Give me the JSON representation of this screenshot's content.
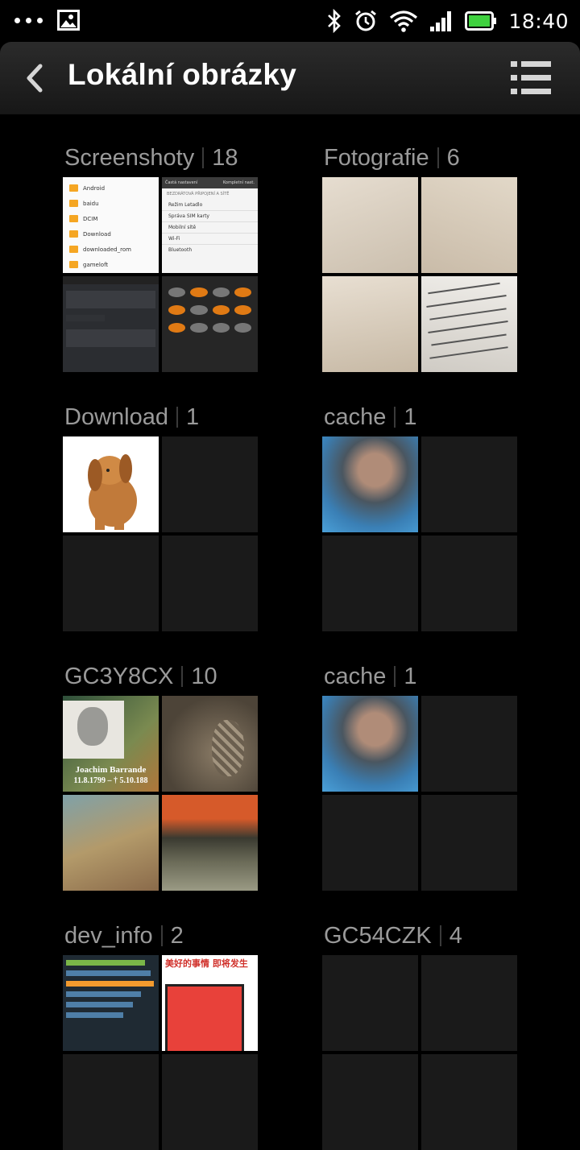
{
  "status_bar": {
    "time": "18:40",
    "icons": [
      "more-dots-icon",
      "image-notification-icon",
      "bluetooth-icon",
      "alarm-icon",
      "wifi-icon",
      "signal-icon",
      "battery-icon"
    ]
  },
  "action_bar": {
    "title": "Lokální obrázky",
    "back_icon": "back-chevron-icon",
    "menu_icon": "list-view-icon"
  },
  "albums": [
    {
      "name": "Screenshoty",
      "count": "18"
    },
    {
      "name": "Fotografie",
      "count": "6"
    },
    {
      "name": "Download",
      "count": "1"
    },
    {
      "name": "cache",
      "count": "1"
    },
    {
      "name": "GC3Y8CX",
      "count": "10"
    },
    {
      "name": "cache",
      "count": "1"
    },
    {
      "name": "dev_info",
      "count": "2"
    },
    {
      "name": "GC54CZK",
      "count": "4"
    }
  ],
  "thumb_text": {
    "screenshot_files": [
      "Android",
      "baidu",
      "DCIM",
      "Download",
      "downloaded_rom",
      "gameloft"
    ],
    "screenshot_settings": {
      "tab_left": "Častá nastavení",
      "tab_right": "Kompletní nast.",
      "section": "BEZDRÁTOVÁ PŘIPOJENÍ A SÍTĚ",
      "items": [
        "Režim Letadlo",
        "Správa SIM karty",
        "Mobilní sítě",
        "Wi-Fi",
        "Bluetooth"
      ]
    },
    "portrait_caption_name": "Joachim Barrande",
    "portrait_caption_dates": "11.8.1799 – † 5.10.188",
    "dev_phone_text": "美好的事情 即将发生"
  },
  "colors": {
    "background": "#000000",
    "album_label": "#9a9a9a",
    "empty_tile": "#1a1a1a",
    "battery_green": "#3fd13f",
    "folder_orange": "#f5a623"
  }
}
